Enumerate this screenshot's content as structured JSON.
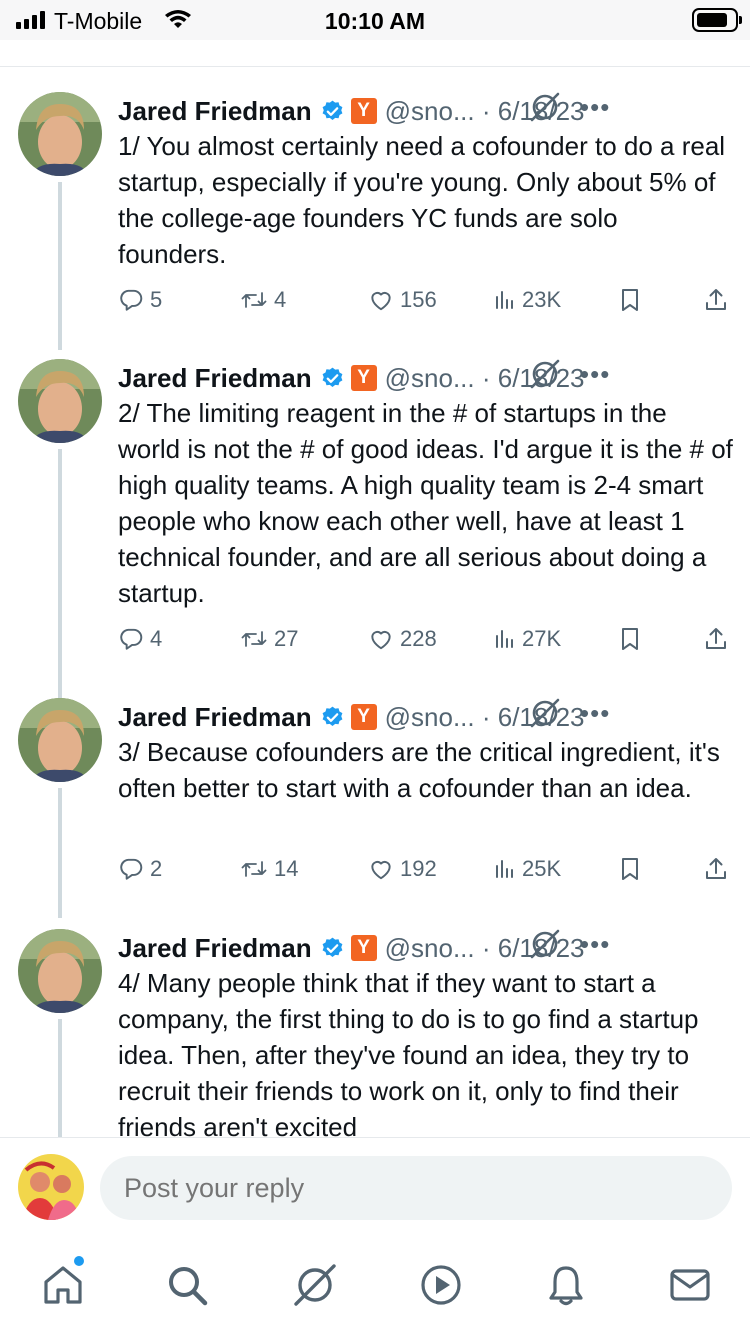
{
  "status_bar": {
    "carrier": "T-Mobile",
    "time": "10:10 AM",
    "signal_icon": "signal-bars-icon",
    "wifi_icon": "wifi-icon",
    "battery_icon": "battery-icon"
  },
  "tweets": [
    {
      "name": "Jared Friedman",
      "badge_text": "Y",
      "handle": "@sno...",
      "date": "· 6/18/23",
      "text": "1/ You almost certainly need a cofounder to do a real startup, especially if you're young.  Only about 5% of the college-age founders YC funds are solo founders.",
      "replies": "5",
      "retweets": "4",
      "likes": "156",
      "views": "23K"
    },
    {
      "name": "Jared Friedman",
      "badge_text": "Y",
      "handle": "@sno...",
      "date": "· 6/18/23",
      "text": "2/ The limiting reagent in the # of startups in the world is not the # of good ideas.  I'd argue it is the # of high quality teams.  A high quality team is 2-4 smart people who know each other well, have at least 1 technical founder, and are all serious about doing a startup.",
      "replies": "4",
      "retweets": "27",
      "likes": "228",
      "views": "27K"
    },
    {
      "name": "Jared Friedman",
      "badge_text": "Y",
      "handle": "@sno...",
      "date": "· 6/18/23",
      "text": "3/  Because cofounders are the critical ingredient, it's often better to start with a cofounder than an idea.",
      "replies": "2",
      "retweets": "14",
      "likes": "192",
      "views": "25K"
    },
    {
      "name": "Jared Friedman",
      "badge_text": "Y",
      "handle": "@sno...",
      "date": "· 6/18/23",
      "text": "4/ Many people think that if they want to start a company, the first thing to do is to go find a startup idea.  Then, after they've found an idea, they try to recruit their friends to work on it, only to find their friends aren't excited"
    }
  ],
  "more_label": "•••",
  "reply_bar": {
    "placeholder": "Post your reply"
  },
  "bottom_nav": {
    "items": [
      "home-icon",
      "search-icon",
      "grok-icon",
      "video-icon",
      "notifications-icon",
      "messages-icon"
    ]
  },
  "colors": {
    "text": "#0f1419",
    "secondary": "#536471",
    "verified": "#1d9bf0",
    "yc_orange": "#f26522",
    "thread_line": "#cfd9de"
  }
}
